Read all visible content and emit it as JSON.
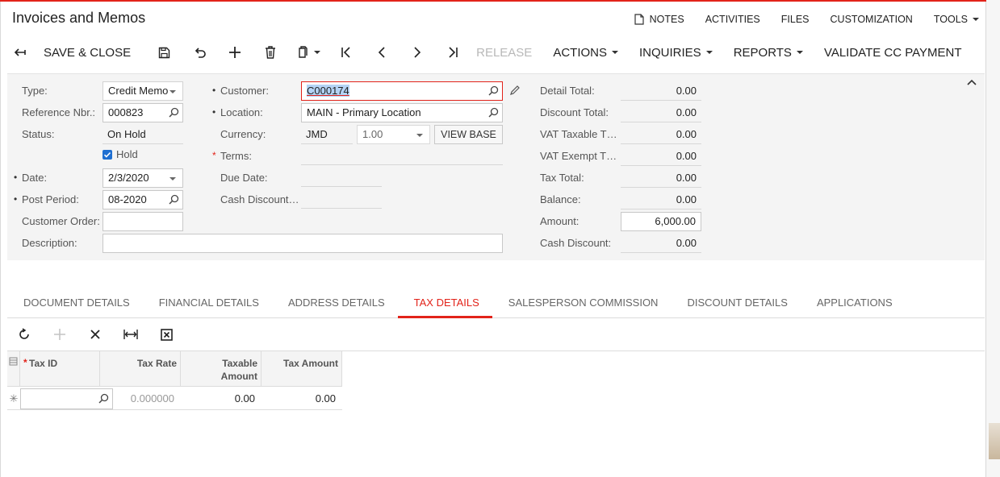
{
  "window": {
    "title": "Invoices and Memos"
  },
  "top_links": {
    "notes": "NOTES",
    "activities": "ACTIVITIES",
    "files": "FILES",
    "customization": "CUSTOMIZATION",
    "tools": "TOOLS"
  },
  "toolbar": {
    "save_close": "SAVE & CLOSE",
    "release": "RELEASE",
    "actions": "ACTIONS",
    "inquiries": "INQUIRIES",
    "reports": "REPORTS",
    "validate": "VALIDATE CC PAYMENT"
  },
  "form": {
    "type": {
      "label": "Type:",
      "value": "Credit Memo"
    },
    "reference": {
      "label": "Reference Nbr.:",
      "value": "000823"
    },
    "status": {
      "label": "Status:",
      "value": "On Hold"
    },
    "hold": {
      "label": "Hold",
      "checked": true
    },
    "date": {
      "label": "Date:",
      "value": "2/3/2020"
    },
    "post_period": {
      "label": "Post Period:",
      "value": "08-2020"
    },
    "customer_order": {
      "label": "Customer Order:",
      "value": ""
    },
    "description": {
      "label": "Description:",
      "value": ""
    },
    "customer": {
      "label": "Customer:",
      "value": "C000174"
    },
    "location": {
      "label": "Location:",
      "value": "MAIN - Primary Location"
    },
    "currency": {
      "label": "Currency:",
      "code": "JMD",
      "rate": "1.00",
      "view_base": "VIEW BASE"
    },
    "terms": {
      "label": "Terms:",
      "value": ""
    },
    "due_date": {
      "label": "Due Date:",
      "value": ""
    },
    "cash_discount_date": {
      "label": "Cash Discount…",
      "value": ""
    },
    "totals": {
      "detail_total": {
        "label": "Detail Total:",
        "value": "0.00"
      },
      "discount_total": {
        "label": "Discount Total:",
        "value": "0.00"
      },
      "vat_taxable": {
        "label": "VAT Taxable T…",
        "value": "0.00"
      },
      "vat_exempt": {
        "label": "VAT Exempt T…",
        "value": "0.00"
      },
      "tax_total": {
        "label": "Tax Total:",
        "value": "0.00"
      },
      "balance": {
        "label": "Balance:",
        "value": "0.00"
      },
      "amount": {
        "label": "Amount:",
        "value": "6,000.00"
      },
      "cash_discount": {
        "label": "Cash Discount:",
        "value": "0.00"
      }
    }
  },
  "tabs": [
    {
      "label": "DOCUMENT DETAILS"
    },
    {
      "label": "FINANCIAL DETAILS"
    },
    {
      "label": "ADDRESS DETAILS"
    },
    {
      "label": "TAX DETAILS",
      "active": true
    },
    {
      "label": "SALESPERSON COMMISSION"
    },
    {
      "label": "DISCOUNT DETAILS"
    },
    {
      "label": "APPLICATIONS"
    }
  ],
  "grid": {
    "headers": {
      "tax_id": "Tax ID",
      "tax_rate": "Tax Rate",
      "taxable_amount_1": "Taxable",
      "taxable_amount_2": "Amount",
      "tax_amount": "Tax Amount"
    },
    "rows": [
      {
        "tax_id": "",
        "tax_rate": "0.000000",
        "taxable_amount": "0.00",
        "tax_amount": "0.00"
      }
    ]
  },
  "colors": {
    "accent": "#e2231a",
    "selection": "#b4d3f5",
    "checkbox": "#1f6fd1"
  },
  "icons": [
    "notes-icon",
    "back-arrow-icon",
    "save-icon",
    "undo-icon",
    "add-icon",
    "delete-icon",
    "copy-paste-icon",
    "first-icon",
    "previous-icon",
    "next-icon",
    "last-icon",
    "search-icon",
    "edit-icon",
    "collapse-icon",
    "refresh-icon",
    "close-icon",
    "fit-columns-icon",
    "excel-export-icon",
    "row-selector-icon",
    "new-row-icon"
  ]
}
